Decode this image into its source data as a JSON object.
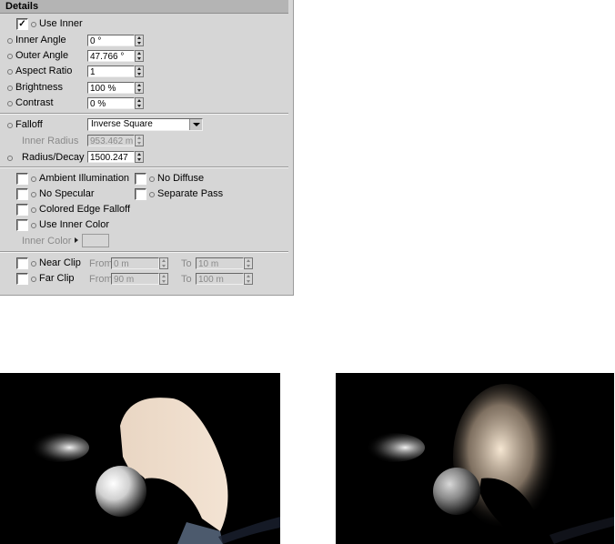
{
  "panel": {
    "title": "Details",
    "use_inner": {
      "label": "Use Inner",
      "checked": true
    },
    "inner_angle": {
      "label": "Inner Angle",
      "value": "0 °"
    },
    "outer_angle": {
      "label": "Outer Angle",
      "value": "47.766 °"
    },
    "aspect_ratio": {
      "label": "Aspect Ratio",
      "value": "1"
    },
    "brightness": {
      "label": "Brightness",
      "value": "100 %"
    },
    "contrast": {
      "label": "Contrast",
      "value": "0 %"
    },
    "falloff": {
      "label": "Falloff",
      "value": "Inverse Square"
    },
    "inner_radius": {
      "label": "Inner Radius",
      "value": "953.462 m"
    },
    "radius_decay": {
      "label": "Radius/Decay",
      "value": "1500.247 m"
    },
    "ambient_illumination": {
      "label": "Ambient Illumination",
      "checked": false
    },
    "no_diffuse": {
      "label": "No Diffuse",
      "checked": false
    },
    "no_specular": {
      "label": "No Specular",
      "checked": false
    },
    "separate_pass": {
      "label": "Separate Pass",
      "checked": false
    },
    "colored_edge_falloff": {
      "label": "Colored Edge Falloff",
      "checked": false
    },
    "use_inner_color": {
      "label": "Use Inner Color",
      "checked": false
    },
    "inner_color": {
      "label": "Inner Color"
    },
    "near_clip": {
      "label": "Near Clip",
      "checked": false,
      "from_label": "From",
      "from_value": "0 m",
      "to_label": "To",
      "to_value": "10 m"
    },
    "far_clip": {
      "label": "Far Clip",
      "checked": false,
      "from_label": "From",
      "from_value": "90 m",
      "to_label": "To",
      "to_value": "100 m"
    }
  },
  "icons": {
    "check": "✓"
  },
  "renders": [
    {
      "name": "hard-edge-render"
    },
    {
      "name": "soft-edge-render"
    }
  ]
}
